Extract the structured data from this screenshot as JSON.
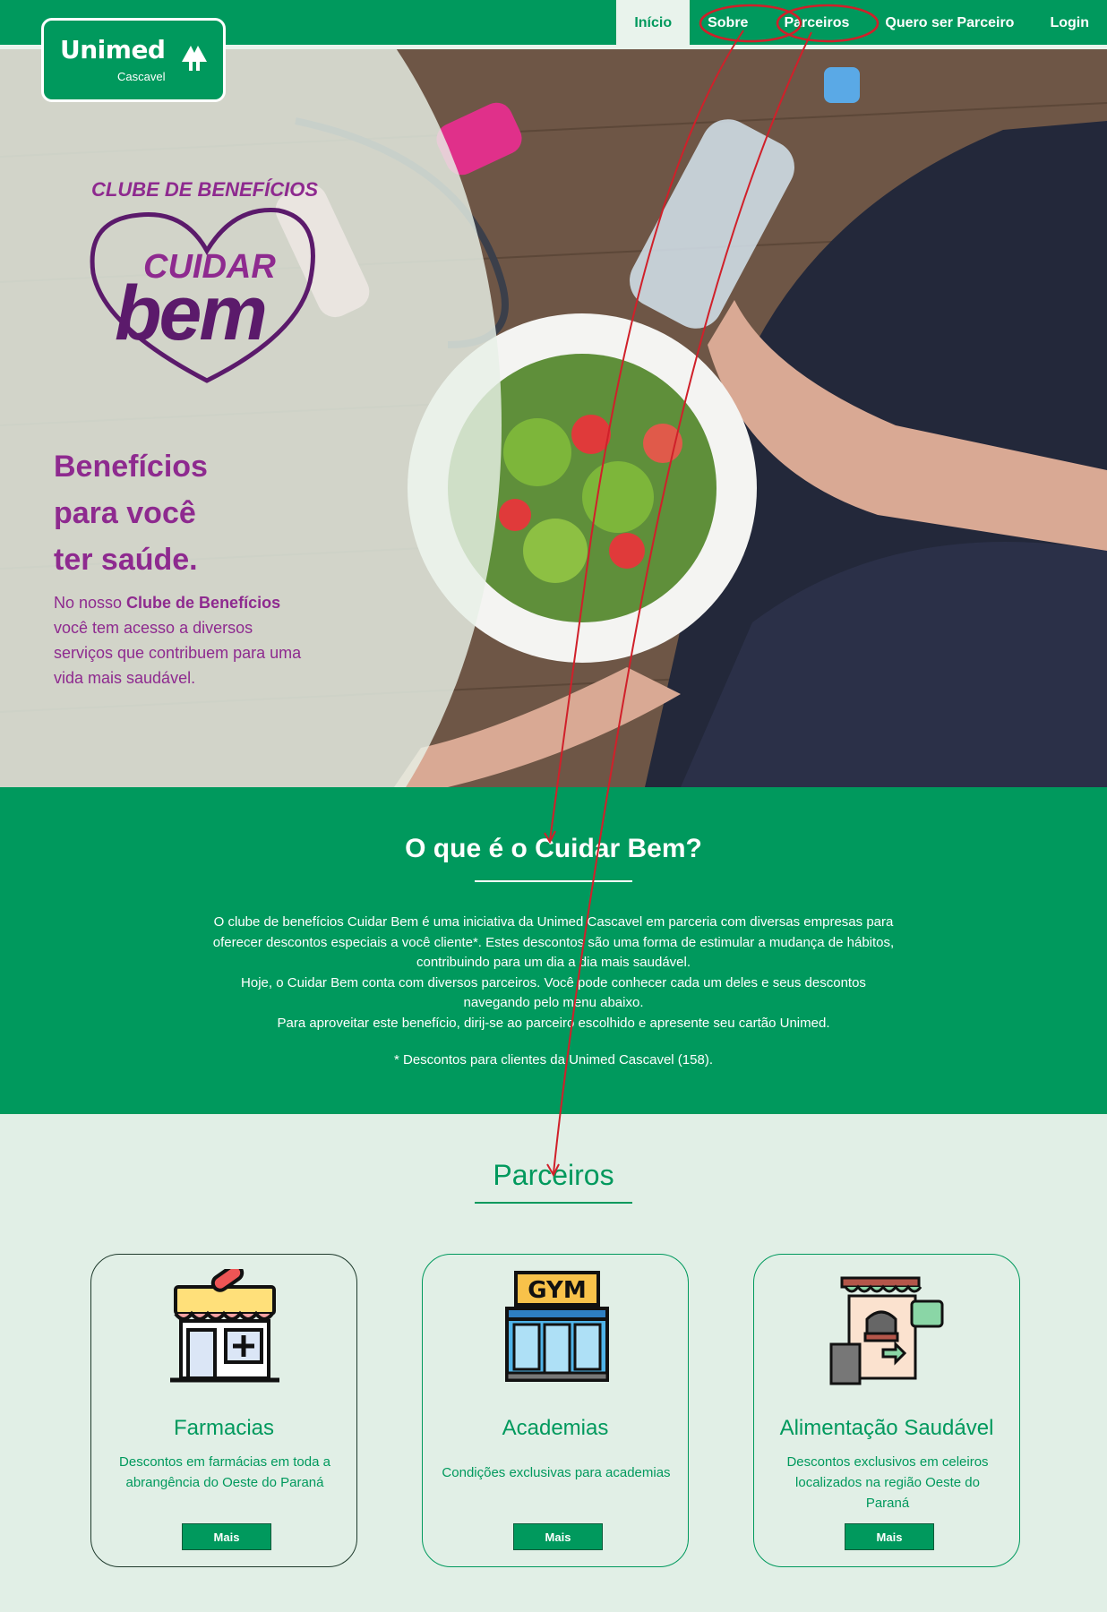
{
  "nav": {
    "items": [
      {
        "label": "Início",
        "active": true
      },
      {
        "label": "Sobre",
        "active": false
      },
      {
        "label": "Parceiros",
        "active": false
      },
      {
        "label": "Quero ser Parceiro",
        "active": false
      },
      {
        "label": "Login",
        "active": false
      }
    ]
  },
  "logo": {
    "brand": "Unimed",
    "city": "Cascavel"
  },
  "hero": {
    "tag": "CLUBE DE BENEFÍCIOS",
    "logo_word1": "CUIDAR",
    "logo_word2": "bem",
    "headline": [
      "Benefícios",
      "para você",
      "ter saúde."
    ],
    "para_prefix": "No nosso ",
    "para_bold": "Clube de Benefícios",
    "para_suffix": " você tem acesso a diversos serviços que contribuem para uma vida mais saudável."
  },
  "about": {
    "title": "O que é o Cuidar Bem?",
    "lines": [
      "O clube de benefícios Cuidar Bem é uma iniciativa da Unimed Cascavel em parceria com diversas empresas para",
      "oferecer descontos especiais a você cliente*. Estes descontos são uma forma de estimular a mudança de hábitos,",
      "contribuindo para um dia a dia mais saudável.",
      "Hoje, o Cuidar Bem conta com diversos parceiros. Você pode conhecer cada um deles e seus descontos",
      "navegando pelo menu abaixo.",
      "Para aproveitar este benefício, dirij-se ao parceiro escolhido e apresente seu cartão Unimed."
    ],
    "note": "* Descontos para clientes da Unimed Cascavel (158)."
  },
  "partners": {
    "title": "Parceiros",
    "cards": [
      {
        "icon": "pharmacy-icon",
        "title": "Farmacias",
        "desc": "Descontos em farmácias em toda a abrangência do Oeste do Paraná",
        "button": "Mais"
      },
      {
        "icon": "gym-icon",
        "title": "Academias",
        "desc": "Condições exclusivas para academias",
        "button": "Mais"
      },
      {
        "icon": "store-icon",
        "title": "Alimentação Saudável",
        "desc": "Descontos exclusivos em celeiros localizados na região Oeste do Paraná",
        "button": "Mais"
      }
    ]
  },
  "gym_sign": "GYM",
  "colors": {
    "brand_green": "#00995d",
    "purple": "#8e2a8f",
    "light_bg": "#e1efe6",
    "annotation_red": "#d0202a"
  }
}
